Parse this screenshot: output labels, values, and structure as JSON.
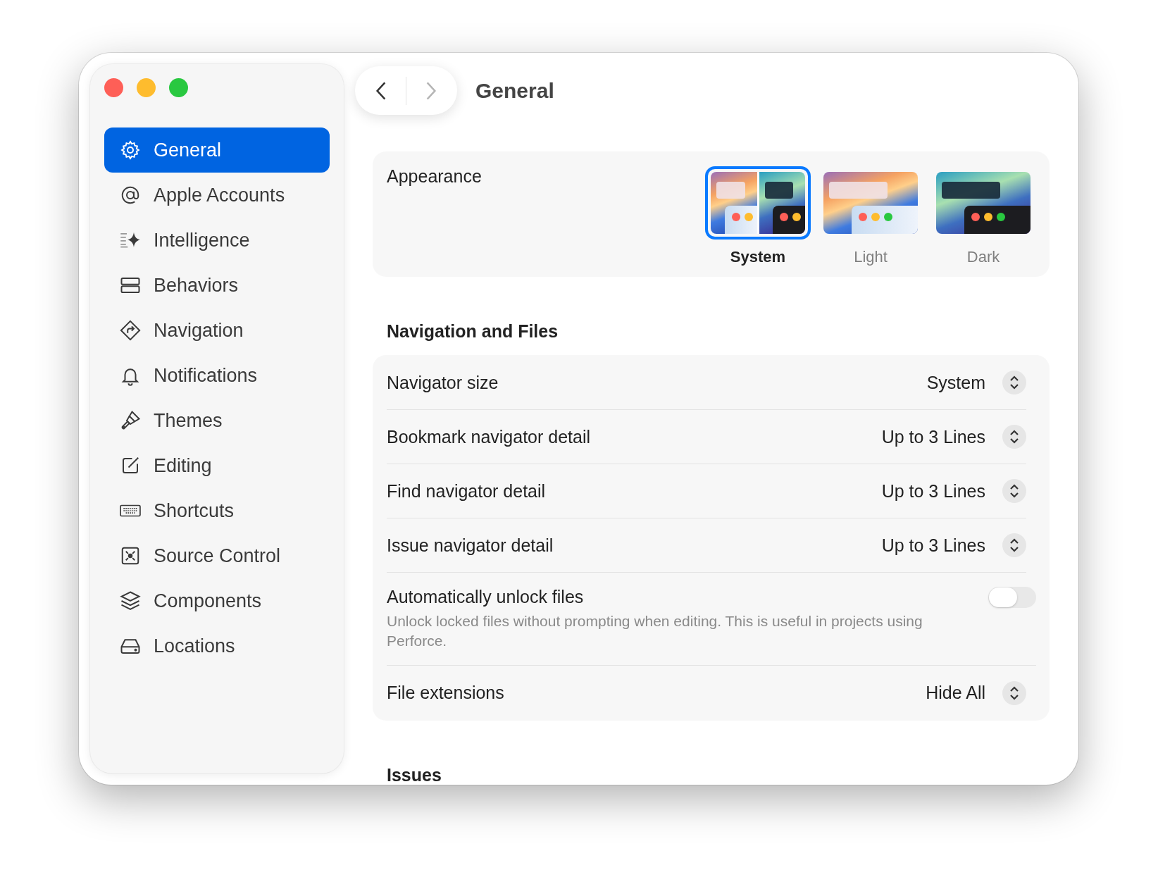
{
  "window": {
    "title": "General"
  },
  "sidebar": {
    "items": [
      {
        "label": "General",
        "selected": true
      },
      {
        "label": "Apple Accounts",
        "selected": false
      },
      {
        "label": "Intelligence",
        "selected": false
      },
      {
        "label": "Behaviors",
        "selected": false
      },
      {
        "label": "Navigation",
        "selected": false
      },
      {
        "label": "Notifications",
        "selected": false
      },
      {
        "label": "Themes",
        "selected": false
      },
      {
        "label": "Editing",
        "selected": false
      },
      {
        "label": "Shortcuts",
        "selected": false
      },
      {
        "label": "Source Control",
        "selected": false
      },
      {
        "label": "Components",
        "selected": false
      },
      {
        "label": "Locations",
        "selected": false
      }
    ]
  },
  "appearance": {
    "label": "Appearance",
    "options": [
      {
        "label": "System",
        "kind": "system",
        "selected": true
      },
      {
        "label": "Light",
        "kind": "light",
        "selected": false
      },
      {
        "label": "Dark",
        "kind": "dark",
        "selected": false
      }
    ]
  },
  "sections": [
    {
      "title": "Navigation and Files",
      "rows": [
        {
          "kind": "popup",
          "label": "Navigator size",
          "value": "System"
        },
        {
          "kind": "popup",
          "label": "Bookmark navigator detail",
          "value": "Up to 3 Lines"
        },
        {
          "kind": "popup",
          "label": "Find navigator detail",
          "value": "Up to 3 Lines"
        },
        {
          "kind": "popup",
          "label": "Issue navigator detail",
          "value": "Up to 3 Lines"
        },
        {
          "kind": "toggle",
          "label": "Automatically unlock files",
          "description": "Unlock locked files without prompting when editing. This is useful in projects using Perforce.",
          "on": false
        },
        {
          "kind": "popup",
          "label": "File extensions",
          "value": "Hide All"
        }
      ]
    },
    {
      "title": "Issues"
    }
  ]
}
